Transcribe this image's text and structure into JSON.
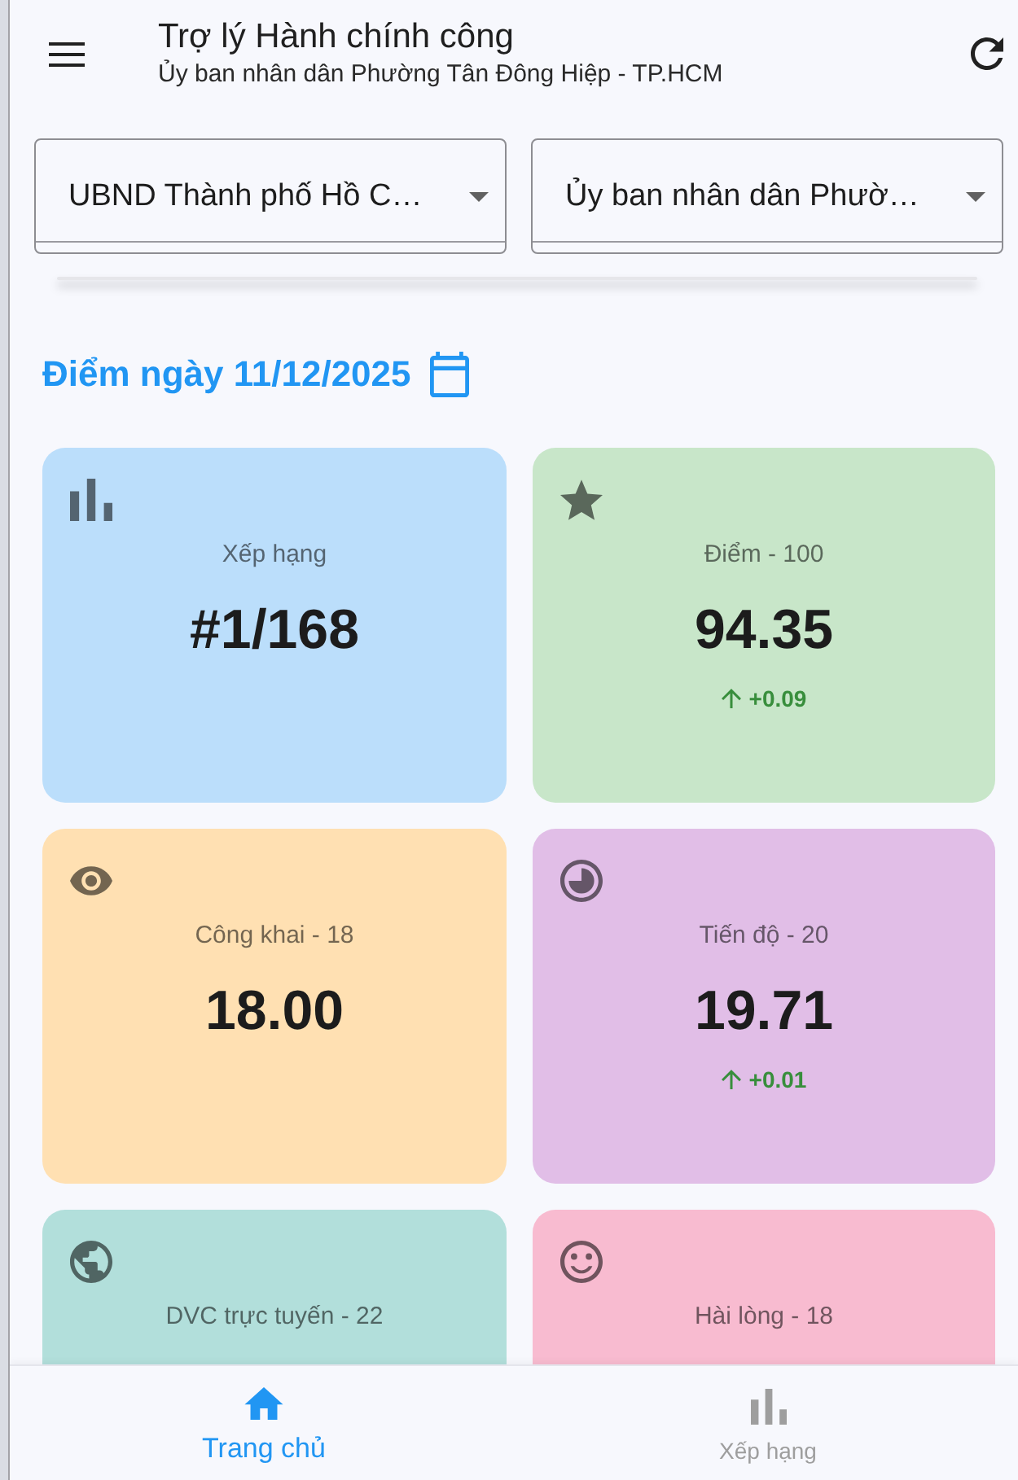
{
  "app_bar": {
    "title": "Trợ lý Hành chính công",
    "subtitle": "Ủy ban nhân dân Phường Tân Đông Hiệp - TP.HCM"
  },
  "filters": [
    {
      "value": "UBND Thành phố Hồ C…"
    },
    {
      "value": "Ủy ban nhân dân Phườ…"
    }
  ],
  "date_heading": "Điểm ngày 11/12/2025",
  "cards": [
    {
      "kind": "ranking",
      "color": "#bbdefb",
      "label": "Xếp hạng",
      "value": "#1/168"
    },
    {
      "kind": "score",
      "color": "#c8e6c9",
      "label": "Điểm - 100",
      "value": "94.35",
      "change": {
        "up": true,
        "text": "+0.09"
      }
    },
    {
      "kind": "publicity",
      "color": "#ffe0b2",
      "label": "Công khai - 18",
      "value": "18.00"
    },
    {
      "kind": "progress",
      "color": "#e1bee7",
      "label": "Tiến độ - 20",
      "value": "19.71",
      "change": {
        "up": true,
        "text": "+0.01"
      }
    },
    {
      "kind": "online",
      "color": "#b2dfdb",
      "label": "DVC trực tuyến - 22"
    },
    {
      "kind": "satisfaction",
      "color": "#f8bbd0",
      "label": "Hài lòng - 18"
    }
  ],
  "bottom_nav": [
    {
      "kind": "home",
      "label": "Trang chủ",
      "selected": true
    },
    {
      "kind": "ranking",
      "label": "Xếp hạng",
      "selected": false
    }
  ]
}
